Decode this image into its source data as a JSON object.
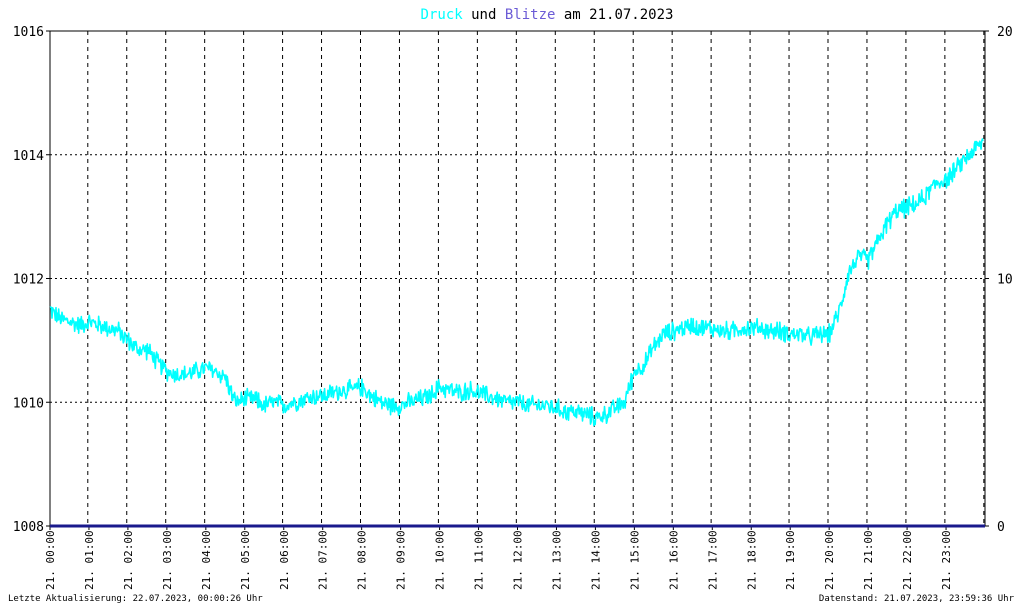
{
  "title": {
    "part1": "Druck",
    "part2": " und ",
    "part3": "Blitze",
    "part4": " am 21.07.2023"
  },
  "footer": {
    "left": "Letzte Aktualisierung: 22.07.2023, 00:00:26 Uhr",
    "right": "Datenstand: 21.07.2023, 23:59:36 Uhr"
  },
  "colors": {
    "druck": "#00ffff",
    "blitze": "#1a1a8c",
    "grid": "#000000",
    "title_druck": "#00ffff",
    "title_blitze": "#6b5bd6"
  },
  "chart_data": {
    "type": "line",
    "grid": true,
    "x_tick_labels": [
      "21. 00:00",
      "21. 01:00",
      "21. 02:00",
      "21. 03:00",
      "21. 04:00",
      "21. 05:00",
      "21. 06:00",
      "21. 07:00",
      "21. 08:00",
      "21. 09:00",
      "21. 10:00",
      "21. 11:00",
      "21. 12:00",
      "21. 13:00",
      "21. 14:00",
      "21. 15:00",
      "21. 16:00",
      "21. 17:00",
      "21. 18:00",
      "21. 19:00",
      "21. 20:00",
      "21. 21:00",
      "21. 22:00",
      "21. 23:00"
    ],
    "xlim_hours": [
      0,
      24
    ],
    "y_left": {
      "ticks": [
        "1008",
        "1010",
        "1012",
        "1014",
        "1016"
      ],
      "ylim": [
        1008,
        1016
      ]
    },
    "y_right": {
      "ticks": [
        "0",
        "10",
        "20"
      ],
      "ylim": [
        0,
        20
      ]
    },
    "series": [
      {
        "name": "Druck",
        "axis": "left",
        "x_hours": [
          0.0,
          0.25,
          0.5,
          0.75,
          1.0,
          1.25,
          1.5,
          1.75,
          2.0,
          2.25,
          2.5,
          2.75,
          3.0,
          3.25,
          3.5,
          3.75,
          4.0,
          4.25,
          4.5,
          4.75,
          5.0,
          5.25,
          5.5,
          5.75,
          6.0,
          6.25,
          6.5,
          6.75,
          7.0,
          7.25,
          7.5,
          7.75,
          8.0,
          8.25,
          8.5,
          8.75,
          9.0,
          9.25,
          9.5,
          9.75,
          10.0,
          10.25,
          10.5,
          10.75,
          11.0,
          11.25,
          11.5,
          11.75,
          12.0,
          12.25,
          12.5,
          12.75,
          13.0,
          13.25,
          13.5,
          13.75,
          14.0,
          14.25,
          14.5,
          14.75,
          15.0,
          15.25,
          15.5,
          15.75,
          16.0,
          16.25,
          16.5,
          16.75,
          17.0,
          17.25,
          17.5,
          17.75,
          18.0,
          18.25,
          18.5,
          18.75,
          19.0,
          19.25,
          19.5,
          19.75,
          20.0,
          20.25,
          20.5,
          20.75,
          21.0,
          21.25,
          21.5,
          21.75,
          22.0,
          22.25,
          22.5,
          22.75,
          23.0,
          23.25,
          23.5,
          23.75,
          23.95
        ],
        "values": [
          1011.5,
          1011.35,
          1011.3,
          1011.25,
          1011.3,
          1011.25,
          1011.2,
          1011.15,
          1011.0,
          1010.85,
          1010.85,
          1010.65,
          1010.5,
          1010.45,
          1010.45,
          1010.5,
          1010.55,
          1010.5,
          1010.4,
          1010.0,
          1010.05,
          1010.05,
          1009.95,
          1010.0,
          1009.95,
          1010.0,
          1010.05,
          1010.1,
          1010.1,
          1010.15,
          1010.2,
          1010.2,
          1010.25,
          1010.1,
          1010.0,
          1009.95,
          1009.95,
          1010.0,
          1010.05,
          1010.1,
          1010.25,
          1010.2,
          1010.15,
          1010.2,
          1010.15,
          1010.1,
          1010.05,
          1010.0,
          1010.0,
          1009.95,
          1009.95,
          1009.95,
          1009.9,
          1009.85,
          1009.85,
          1009.8,
          1009.75,
          1009.8,
          1009.9,
          1010.0,
          1010.5,
          1010.6,
          1010.9,
          1011.1,
          1011.15,
          1011.2,
          1011.25,
          1011.2,
          1011.2,
          1011.15,
          1011.15,
          1011.2,
          1011.2,
          1011.2,
          1011.15,
          1011.15,
          1011.1,
          1011.1,
          1011.05,
          1011.1,
          1011.1,
          1011.45,
          1012.1,
          1012.35,
          1012.3,
          1012.6,
          1012.9,
          1013.1,
          1013.15,
          1013.2,
          1013.35,
          1013.55,
          1013.6,
          1013.75,
          1013.95,
          1014.1,
          1014.2
        ],
        "noise_amplitude": 0.18
      },
      {
        "name": "Blitze",
        "axis": "right",
        "x_hours": [
          0,
          24
        ],
        "values": [
          0,
          0
        ]
      }
    ]
  }
}
